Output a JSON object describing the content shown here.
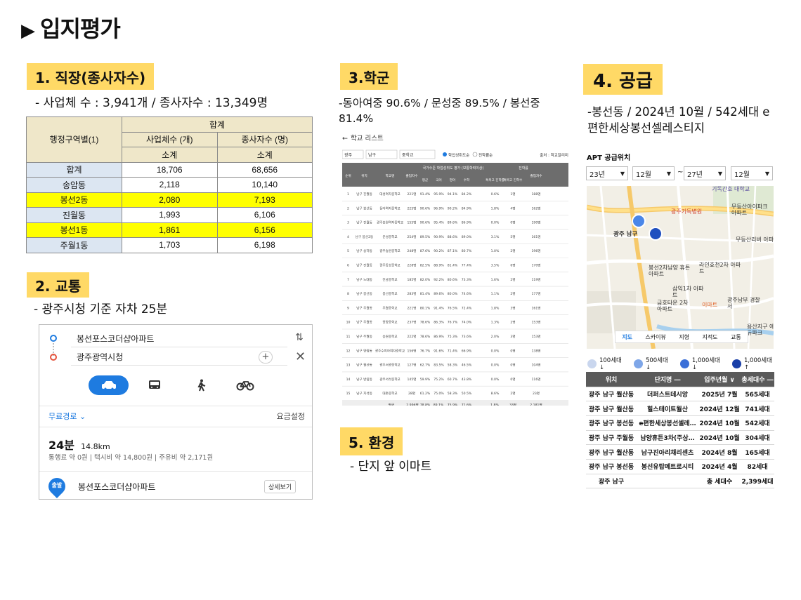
{
  "page_title": "입지평가",
  "sections": {
    "jobs": {
      "label": "1. 직장(종사자수)",
      "text": "- 사업체 수 : 3,941개 / 종사자수 : 13,349명",
      "table": {
        "row_header": "행정구역별(1)",
        "group_header": "합계",
        "col1": "사업체수 (개)",
        "col2": "종사자수 (명)",
        "unit1": "소계",
        "unit2": "소계",
        "rows": [
          {
            "name": "합계",
            "a": "18,706",
            "b": "68,656",
            "hl": false
          },
          {
            "name": "송암동",
            "a": "2,118",
            "b": "10,140",
            "hl": false
          },
          {
            "name": "봉선2동",
            "a": "2,080",
            "b": "7,193",
            "hl": true
          },
          {
            "name": "진월동",
            "a": "1,993",
            "b": "6,106",
            "hl": false
          },
          {
            "name": "봉선1동",
            "a": "1,861",
            "b": "6,156",
            "hl": true
          },
          {
            "name": "주월1동",
            "a": "1,703",
            "b": "6,198",
            "hl": false
          }
        ]
      }
    },
    "traffic": {
      "label": "2. 교통",
      "text": "- 광주시청 기준 자차 25분",
      "route": {
        "origin": "봉선포스코더샵아파트",
        "destination": "광주광역시청",
        "route_type": "무료경로",
        "fare_setting": "요금설정",
        "time": "24분",
        "distance": "14.8km",
        "detail": "통행료 약 0원 | 택시비 약 14,800원 | 주유비 약 2,171원",
        "start_badge": "출발",
        "start_name": "봉선포스코더샵아파트",
        "detail_button": "상세보기"
      }
    },
    "school": {
      "label": "3.학군",
      "text": "-동아여중 90.6% / 문성중 89.5% / 봉선중 81.4%",
      "list_title": "학교 리스트",
      "filters": [
        "광주",
        "남구",
        "중학교"
      ],
      "radio1": "학업성취도순",
      "radio2": "진학률순",
      "source": "출처 : 학교알리미",
      "headers": [
        "순위",
        "위치",
        "학교명",
        "졸업자수",
        "국가수준 학업성취도 평가 (보통학력이상)",
        "평균",
        "국어",
        "영어",
        "수학",
        "진학률",
        "특목고 진학률",
        "특목고 진학수",
        "졸업자수"
      ],
      "rows": [
        [
          "1",
          "남구 진월동",
          "대성여자중학교",
          "221명",
          "91.4%",
          "95.9%",
          "94.1%",
          "84.2%",
          "0.6%",
          "1명",
          "188명"
        ],
        [
          "2",
          "남구 봉선동",
          "동아여자중학교",
          "225명",
          "90.6%",
          "96.9%",
          "90.2%",
          "84.9%",
          "1.8%",
          "4명",
          "162명"
        ],
        [
          "3",
          "남구 진월동",
          "광주송원여자중학교",
          "155명",
          "90.6%",
          "95.4%",
          "89.6%",
          "86.9%",
          "0.0%",
          "0명",
          "190명"
        ],
        [
          "4",
          "남구 봉선2동",
          "문성중학교",
          "254명",
          "89.5%",
          "90.9%",
          "88.6%",
          "89.0%",
          "3.1%",
          "5명",
          "161명"
        ],
        [
          "5",
          "남구 송하동",
          "광주송원중학교",
          "248명",
          "87.6%",
          "90.2%",
          "87.1%",
          "80.7%",
          "1.0%",
          "2명",
          "196명"
        ],
        [
          "6",
          "남구 진월동",
          "광주동성중학교",
          "228명",
          "82.5%",
          "88.9%",
          "81.4%",
          "77.4%",
          "3.5%",
          "6명",
          "170명"
        ],
        [
          "7",
          "남구 노대동",
          "진남중학교",
          "185명",
          "82.0%",
          "92.2%",
          "80.6%",
          "73.3%",
          "1.6%",
          "2명",
          "119명"
        ],
        [
          "8",
          "남구 봉선동",
          "봉선중학교",
          "283명",
          "81.4%",
          "89.6%",
          "80.0%",
          "74.6%",
          "1.1%",
          "2명",
          "177명"
        ],
        [
          "9",
          "남구 주월동",
          "주월중학교",
          "221명",
          "80.1%",
          "91.4%",
          "76.5%",
          "72.4%",
          "1.8%",
          "3명",
          "161명"
        ],
        [
          "10",
          "남구 주월동",
          "광양중학교",
          "237명",
          "78.6%",
          "86.3%",
          "76.7%",
          "74.0%",
          "1.3%",
          "2명",
          "153명"
        ],
        [
          "11",
          "남구 주월동",
          "송원중학교",
          "222명",
          "78.6%",
          "86.9%",
          "75.3%",
          "73.6%",
          "2.0%",
          "3명",
          "153명"
        ],
        [
          "12",
          "남구 양림동",
          "광주수피아여자중학교",
          "156명",
          "76.7%",
          "91.6%",
          "71.4%",
          "66.9%",
          "0.0%",
          "0명",
          "138명"
        ],
        [
          "13",
          "남구 월산동",
          "광주서광중학교",
          "127명",
          "62.7%",
          "83.5%",
          "58.3%",
          "46.5%",
          "0.0%",
          "0명",
          "104명"
        ],
        [
          "14",
          "남구 방림동",
          "광주서석중학교",
          "145명",
          "59.9%",
          "75.2%",
          "60.7%",
          "43.8%",
          "0.0%",
          "0명",
          "116명"
        ],
        [
          "15",
          "남구 지석동",
          "대촌중학교",
          "28명",
          "61.2%",
          "75.0%",
          "58.3%",
          "50.5%",
          "8.6%",
          "2명",
          "23명"
        ]
      ],
      "footer": [
        "평균",
        "2,996명",
        "78.8%",
        "89.1%",
        "75.9%",
        "71.6%",
        "1.8%",
        "33명",
        "2,181명"
      ]
    },
    "supply": {
      "label": "4. 공급",
      "text": "-봉선동 / 2024년 10월 / 542세대 e편한세상봉선셀레스티지",
      "map_title": "APT 공급위치",
      "selects": [
        "23년",
        "12월",
        "~",
        "27년",
        "12월"
      ],
      "map_labels": {
        "univ": "기독간호 대학교",
        "mudeung_apt": "무등산아이파크 아파트",
        "hospital": "광주기독병원",
        "namgu": "광주 남구",
        "mudeung2": "무등산리버 아파",
        "bongseon": "봉선2차남양 휴튼아파트",
        "laine": "라인효천2차 아파트",
        "samik": "삼익1차 아파트",
        "emart": "이마트",
        "geumho": "금호타운 2차아파트",
        "police": "광주남부 경찰서",
        "yongsan": "용산지구 에듀파크"
      },
      "map_tabs": [
        "지도",
        "스카이뷰",
        "지형",
        "지적도",
        "교통"
      ],
      "legend": [
        "100세대↓",
        "500세대↓",
        "1,000세대↓",
        "1,000세대↑"
      ],
      "table_headers": [
        "위치",
        "단지명 ―",
        "입주년월 ∨",
        "총세대수 ―"
      ],
      "table_rows": [
        [
          "광주 남구 월산동",
          "더퍼스트데시앙",
          "2025년 7월",
          "565세대"
        ],
        [
          "광주 남구 월산동",
          "힐스테이트월산",
          "2024년 12월",
          "741세대"
        ],
        [
          "광주 남구 봉선동",
          "e편한세상봉선셀레…",
          "2024년 10월",
          "542세대"
        ],
        [
          "광주 남구 주월동",
          "남양휴튼3차(주상…",
          "2024년 10월",
          "304세대"
        ],
        [
          "광주 남구 월산동",
          "남구진아리채리센츠",
          "2024년 8월",
          "165세대"
        ],
        [
          "광주 남구 봉선동",
          "봉선유탑메트로시티",
          "2024년 4월",
          "82세대"
        ]
      ],
      "total_row": [
        "광주 남구",
        "",
        "총 세대수",
        "2,399세대"
      ]
    },
    "environment": {
      "label": "5. 환경",
      "text": "- 단지 앞 이마트"
    }
  },
  "colors": {
    "label_bg": "#ffd966",
    "highlight": "#ffff00",
    "route_blue": "#1e7be0"
  }
}
